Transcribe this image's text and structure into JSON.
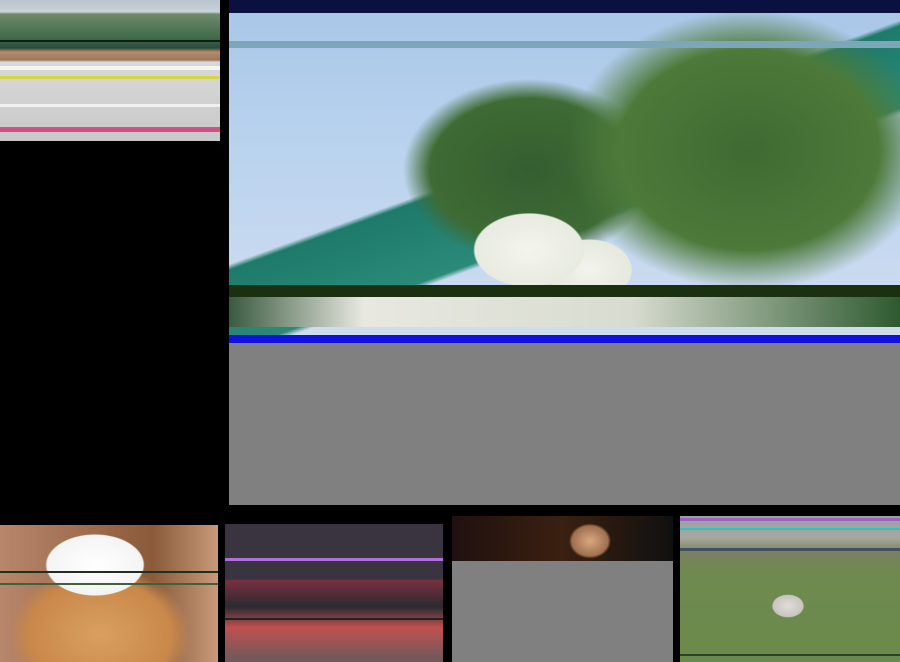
{
  "tiles": [
    {
      "subject": "track",
      "accent": "#c9c9c9"
    },
    {
      "subject": "butterflies-flowers",
      "accent": "#a9c6e8"
    },
    {
      "subject": "guinea-pig-sunglasses",
      "accent": "#c9884a"
    },
    {
      "subject": "children-stage",
      "accent": "#3a3440"
    },
    {
      "subject": "girl-stage",
      "accent": "#3a2010"
    },
    {
      "subject": "goat-field",
      "accent": "#6f8a50"
    }
  ],
  "placeholder_color": "#808080"
}
